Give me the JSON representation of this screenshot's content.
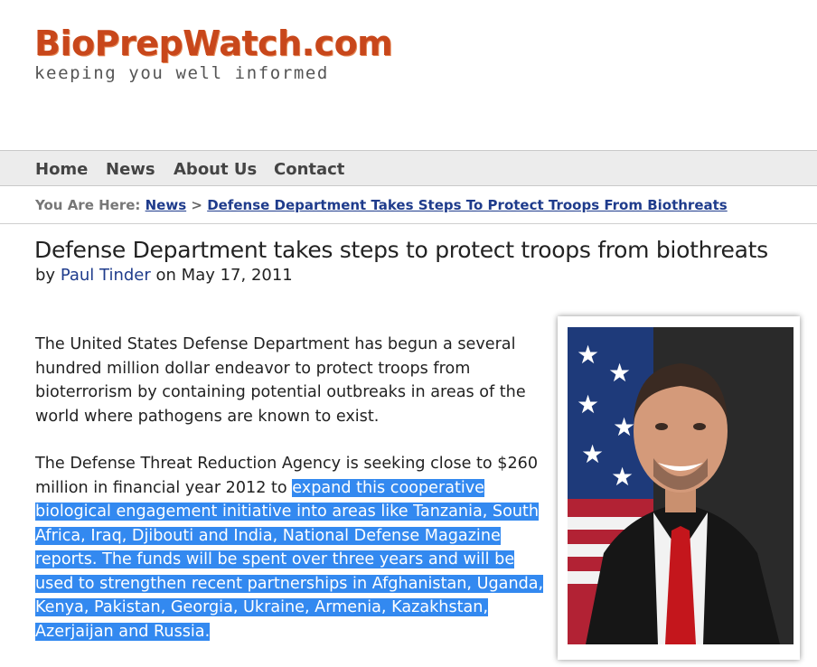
{
  "site": {
    "logo_title": "BioPrepWatch.com",
    "logo_tagline": "keeping you well informed",
    "brand_color": "#c8471b"
  },
  "nav": {
    "items": [
      {
        "label": "Home"
      },
      {
        "label": "News"
      },
      {
        "label": "About Us"
      },
      {
        "label": "Contact"
      }
    ]
  },
  "breadcrumb": {
    "label": "You Are Here:",
    "items": [
      {
        "label": "News"
      },
      {
        "label": "Defense Department Takes Steps To Protect Troops From Biothreats"
      }
    ],
    "separator": ">"
  },
  "article": {
    "title": "Defense Department takes steps to protect troops from biothreats",
    "by_prefix": "by",
    "author": "Paul Tinder",
    "date_prefix": "on",
    "date": "May 17, 2011",
    "paragraph1": "The United States Defense Department has begun a several hundred million dollar endeavor to protect troops from bioterrorism by containing potential outbreaks in areas of the world where pathogens are known to exist.",
    "paragraph2_plain": "The Defense Threat Reduction Agency is seeking close to $260 million in financial year 2012 to ",
    "paragraph2_selected": "expand this cooperative biological engagement initiative into areas like Tanzania, South Africa, Iraq, Djibouti and India, National Defense Magazine reports. The funds will be spent over three years and will be used to strengthen recent partnerships in Afghanistan, Uganda, Kenya, Pakistan, Georgia, Ukraine, Armenia, Kazakhstan, Azerjaijan and Russia.",
    "selection_color": "#3389f0",
    "link_color": "#1f3c8c"
  }
}
